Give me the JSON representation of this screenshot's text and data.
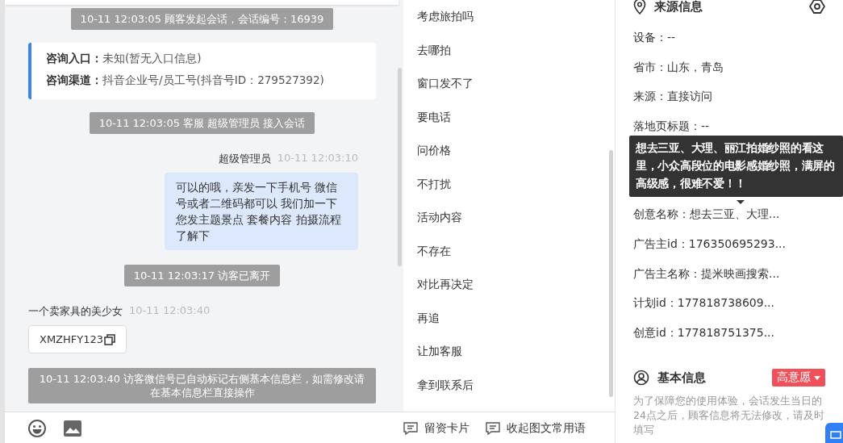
{
  "chat": {
    "messages": [
      {
        "kind": "system",
        "text": "10-11 12:03:05 顾客发起会话，会话编号：16939"
      },
      {
        "kind": "info_card",
        "fields": [
          {
            "label": "咨询入口：",
            "value": "未知(暂无入口信息)"
          },
          {
            "label": "咨询渠道：",
            "value": "抖音企业号/员工号(抖音号ID：279527392)"
          }
        ]
      },
      {
        "kind": "system",
        "text": "10-11 12:03:05 客服 超级管理员 接入会话"
      },
      {
        "kind": "agent",
        "sender": "超级管理员",
        "time": "10-11 12:03:10",
        "text": "可以的哦，亲发一下手机号 微信号或者二维码都可以 我们加一下您发主题景点 套餐内容 拍摄流程了解下"
      },
      {
        "kind": "system",
        "text": "10-11 12:03:17 访客已离开"
      },
      {
        "kind": "visitor",
        "sender": "一个卖家具的美少女",
        "time": "10-11 12:03:40",
        "text": "XMZHFY123"
      },
      {
        "kind": "system",
        "text": "10-11 12:03:40 访客微信号已自动标记右侧基本信息栏，如需修改请在基本信息栏直接操作"
      }
    ]
  },
  "quick_phrases": [
    "考虑旅拍吗",
    "去哪拍",
    "窗口发不了",
    "要电话",
    "问价格",
    "不打扰",
    "活动内容",
    "不存在",
    "对比再决定",
    "再追",
    "让加客服",
    "拿到联系后"
  ],
  "phrase_tools": [
    "留资卡片",
    "收起图文常用语"
  ],
  "source_info": {
    "title": "来源信息",
    "fields_top": [
      "设备：--",
      "省市：山东，青岛",
      "来源：直接访问",
      "落地页标题：--"
    ],
    "fields_bottom": [
      "创意名称：想去三亚、大理...",
      "广告主id：176350695293...",
      "广告主名称：提米映画搜索...",
      "计划id：177818738609...",
      "创意id：177818751375..."
    ]
  },
  "tooltip": {
    "text": "想去三亚、大理、丽江拍婚纱照的看这里，小众高段位的电影感婚纱照，满屏的高级感，很难不爱！！"
  },
  "basic_info": {
    "title": "基本信息",
    "intent_tag": {
      "label": "高意愿",
      "color": "#f0505a"
    },
    "notice": "为了保障您的使用体验，会话发生当日的24点之后，顾客信息将无法修改，请及时填写"
  }
}
